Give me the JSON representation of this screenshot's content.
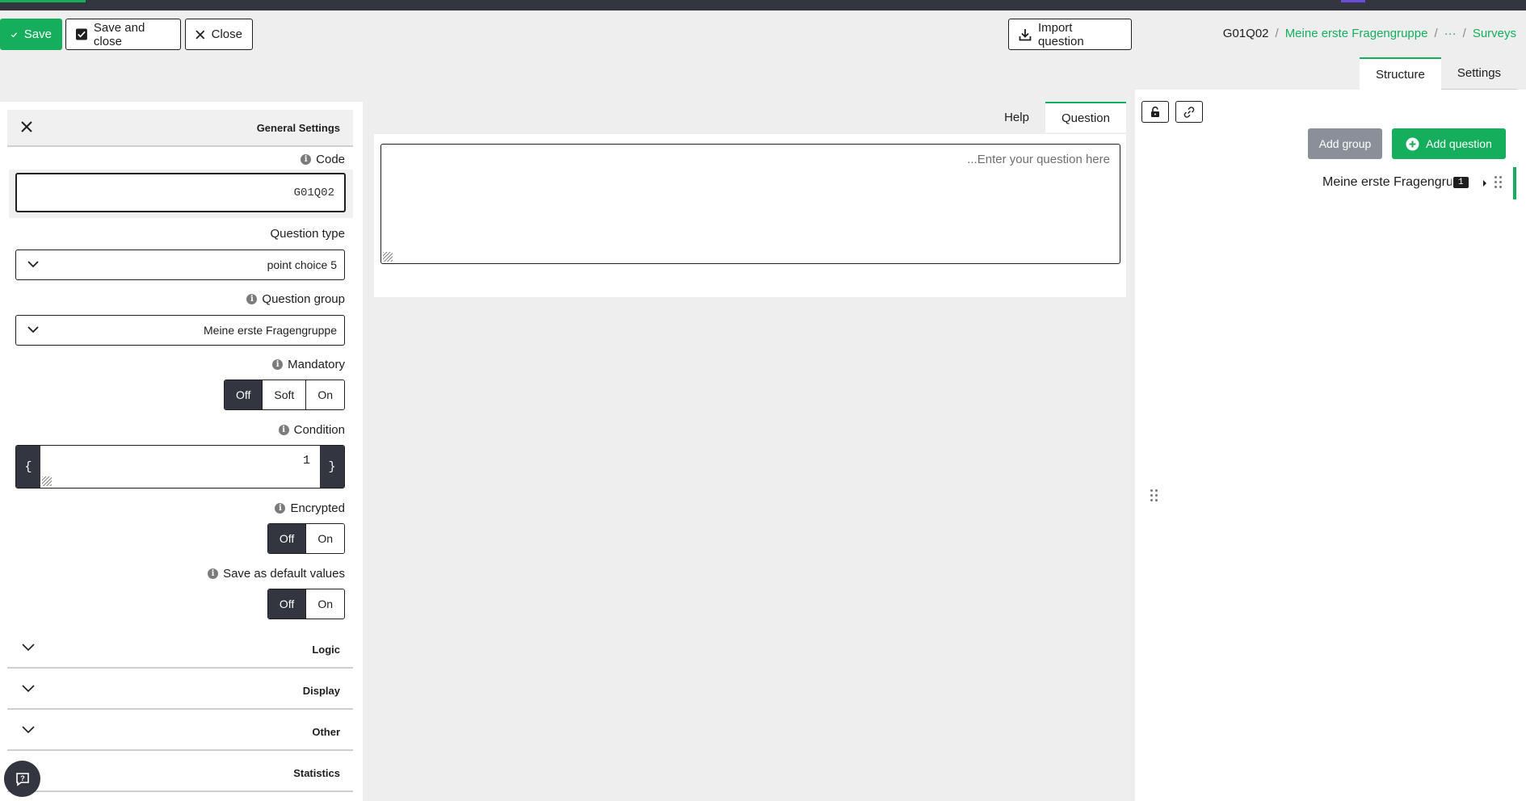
{
  "toolbar": {
    "save_label": "Save",
    "save_close_label": "Save and close",
    "close_label": "Close",
    "import_label": "Import question"
  },
  "breadcrumb": {
    "current": "G01Q02",
    "group": "Meine erste Fragengruppe",
    "ellipsis": "···",
    "surveys": "Surveys"
  },
  "right_tabs": [
    "Structure",
    "Settings"
  ],
  "settings": {
    "header": "General Settings",
    "code_label": "Code",
    "code_value": "G01Q02",
    "question_type_label": "Question type",
    "question_type_value": "point choice 5",
    "question_group_label": "Question group",
    "question_group_value": "Meine erste Fragengruppe",
    "mandatory_label": "Mandatory",
    "mandatory_options": [
      "Off",
      "Soft",
      "On"
    ],
    "mandatory_selected": "Off",
    "condition_label": "Condition",
    "condition_open": "{",
    "condition_value": "1",
    "condition_close": "}",
    "encrypted_label": "Encrypted",
    "encrypted_options": [
      "Off",
      "On"
    ],
    "save_default_label": "Save as default values",
    "save_default_options": [
      "Off",
      "On"
    ]
  },
  "accordions": [
    "Logic",
    "Display",
    "Other",
    "Statistics"
  ],
  "editor": {
    "tabs": [
      "Help",
      "Question"
    ],
    "active_tab": "Question",
    "placeholder": "...Enter your question here"
  },
  "structure": {
    "add_group_label": "Add group",
    "add_question_label": "Add question",
    "group_name": "Meine erste Fragengruppe",
    "group_count": "1"
  },
  "colors": {
    "accent": "#14ae5c",
    "dark": "#333641"
  }
}
